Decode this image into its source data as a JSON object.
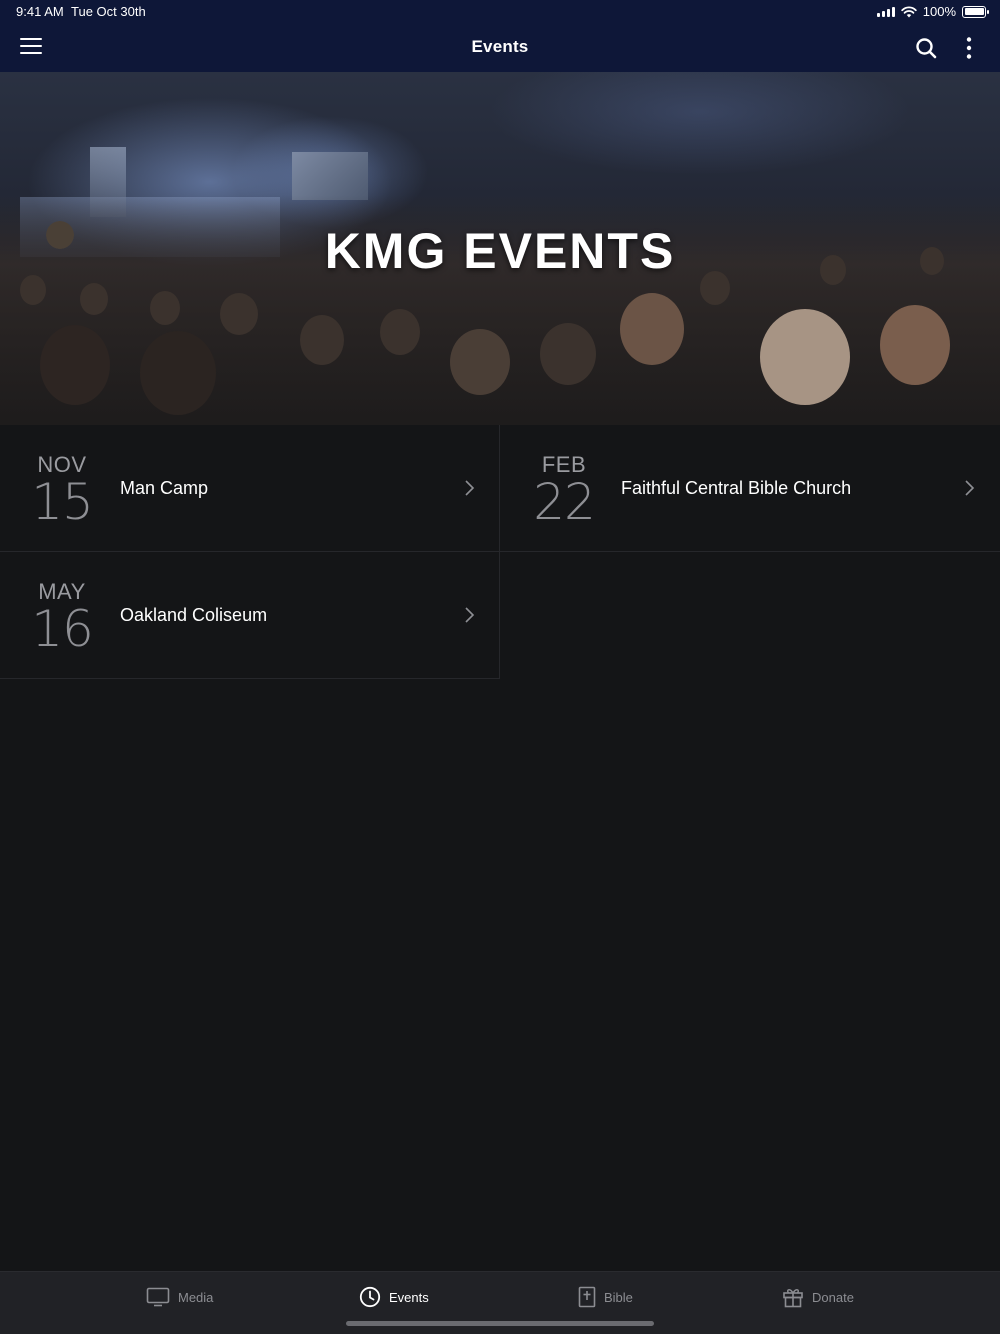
{
  "status": {
    "time": "9:41 AM",
    "date": "Tue Oct 30th",
    "battery": "100%"
  },
  "nav": {
    "title": "Events",
    "icons": [
      "menu-icon",
      "search-icon",
      "more-vertical-icon"
    ]
  },
  "hero": {
    "title": "KMG EVENTS"
  },
  "events": [
    {
      "month": "NOV",
      "day": "15",
      "name": "Man Camp"
    },
    {
      "month": "FEB",
      "day": "22",
      "name": "Faithful Central Bible Church"
    },
    {
      "month": "MAY",
      "day": "16",
      "name": "Oakland Coliseum"
    }
  ],
  "tabs": [
    {
      "label": "Media",
      "icon": "tv-icon",
      "active": false
    },
    {
      "label": "Events",
      "icon": "clock-icon",
      "active": true
    },
    {
      "label": "Bible",
      "icon": "bible-icon",
      "active": false
    },
    {
      "label": "Donate",
      "icon": "gift-icon",
      "active": false
    }
  ],
  "colors": {
    "nav_bg": "#0e1738",
    "page_bg": "#141517",
    "tabbar_bg": "#212226",
    "active_tab": "#ffffff",
    "inactive_tab": "#8c8d92"
  }
}
